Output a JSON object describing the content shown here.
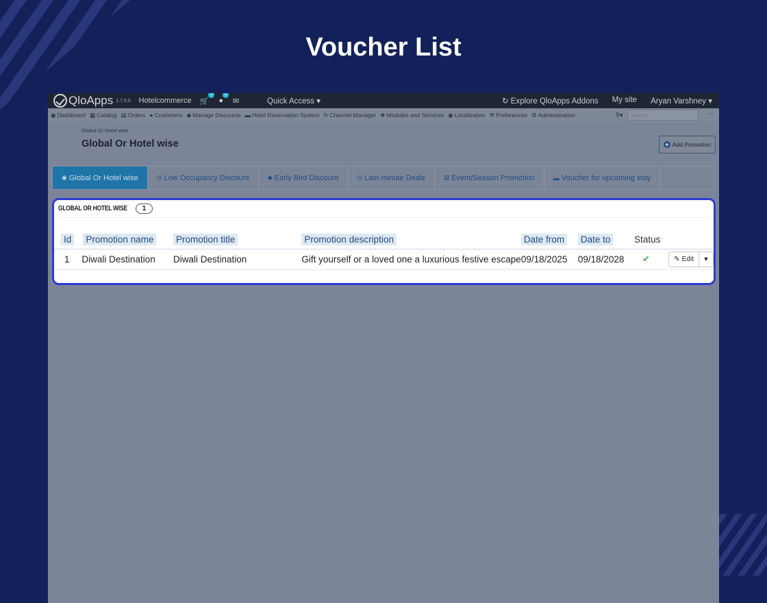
{
  "heading": "Voucher List",
  "topbar": {
    "brand": "QloApps",
    "version": "1.7.0.0",
    "shop": "Hotelcommerce",
    "cart_badge": "0",
    "user_badge": "1",
    "quick_access": "Quick Access ▾",
    "explore": "Explore QloApps Addons",
    "my_site": "My site",
    "user": "Aryan Varshney ▾"
  },
  "nav": {
    "items": [
      "Dashboard",
      "Catalog",
      "Orders",
      "Customers",
      "Manage Discounts",
      "Hotel Reservation System",
      "Channel Manager",
      "Modules and Services",
      "Localization",
      "Preferences",
      "Administration"
    ],
    "search_placeholder": "Search"
  },
  "header": {
    "breadcrumb": "Global Or Hotel wise",
    "title": "Global Or Hotel wise",
    "add_button": "Add Promotion"
  },
  "tabs": [
    {
      "label": "Global Or Hotel wise",
      "icon": "globe-icon"
    },
    {
      "label": "Low Occupancy Discount",
      "icon": "clock-icon"
    },
    {
      "label": "Early Bird Discount",
      "icon": "tag-icon"
    },
    {
      "label": "Last-minute Deals",
      "icon": "clock-icon"
    },
    {
      "label": "Event/Season Promotion",
      "icon": "calendar-icon"
    },
    {
      "label": "Voucher for upcoming stay",
      "icon": "bed-icon"
    }
  ],
  "panel": {
    "title": "GLOBAL OR HOTEL WISE",
    "count": "1",
    "columns": [
      "Id",
      "Promotion name",
      "Promotion title",
      "Promotion description",
      "Date from",
      "Date to",
      "Status"
    ],
    "rows": [
      {
        "id": "1",
        "name": "Diwali Destination",
        "title": "Diwali Destination",
        "description": "Gift yourself or a loved one a luxurious festive escape",
        "date_from": "09/18/2025",
        "date_to": "09/18/2028",
        "status": "enabled"
      }
    ],
    "edit_label": "Edit"
  },
  "colors": {
    "background": "#13215a",
    "highlight_border": "#2d3ad2",
    "active_tab": "#1f74a8",
    "status_green": "#4caf50"
  }
}
